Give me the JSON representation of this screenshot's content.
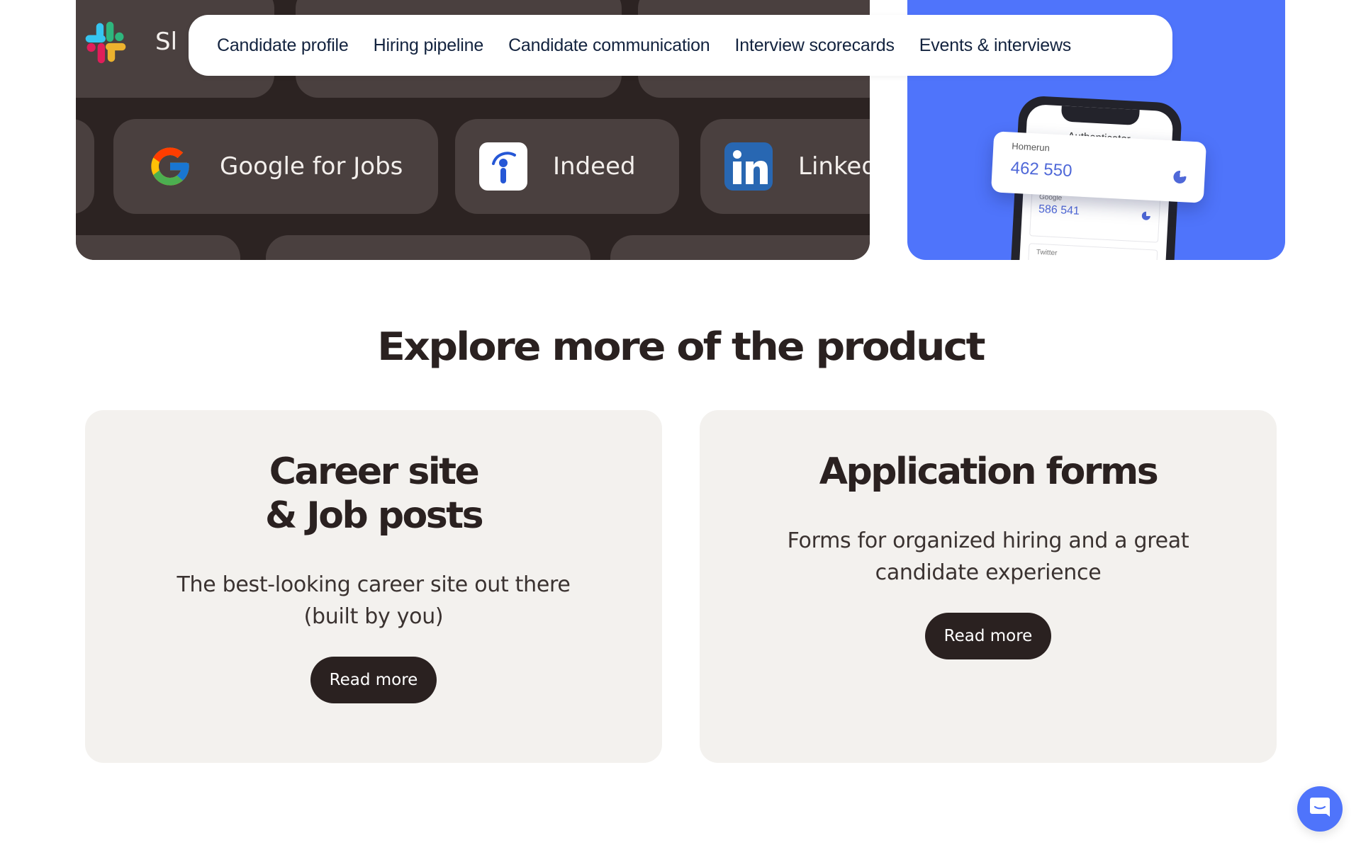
{
  "colors": {
    "dark_panel": "#2c2322",
    "pill": "#4a403f",
    "accent_blue": "#4f74fb",
    "nav_text": "#13233f",
    "heading": "#2a2120",
    "card_bg": "#f3f1ee",
    "button_bg": "#2a2120"
  },
  "integrations": {
    "items": [
      {
        "label": "Sl",
        "icon": "slack-icon"
      },
      {
        "label": "Google for Jobs",
        "icon": "google-icon"
      },
      {
        "label": "Indeed",
        "icon": "indeed-icon"
      },
      {
        "label": "Linked",
        "icon": "linkedin-icon"
      }
    ]
  },
  "feature_nav": {
    "items": [
      {
        "label": "Candidate profile"
      },
      {
        "label": "Hiring pipeline"
      },
      {
        "label": "Candidate communication"
      },
      {
        "label": "Interview scorecards"
      },
      {
        "label": "Events & interviews"
      }
    ]
  },
  "authenticator": {
    "title": "Authenticator",
    "entries": [
      {
        "service": "Homerun",
        "code": "462 550"
      },
      {
        "service": "Google",
        "code": "586 541"
      },
      {
        "service": "Twitter",
        "code": ""
      }
    ]
  },
  "section": {
    "title": "Explore more of the product"
  },
  "cards": [
    {
      "title": "Career site\n& Job posts",
      "description": "The best-looking career site out there\n(built by you)",
      "button": "Read more"
    },
    {
      "title": "Application forms",
      "description": "Forms for organized hiring and a great\ncandidate experience",
      "button": "Read more"
    }
  ],
  "chat": {
    "icon": "chat-icon"
  }
}
